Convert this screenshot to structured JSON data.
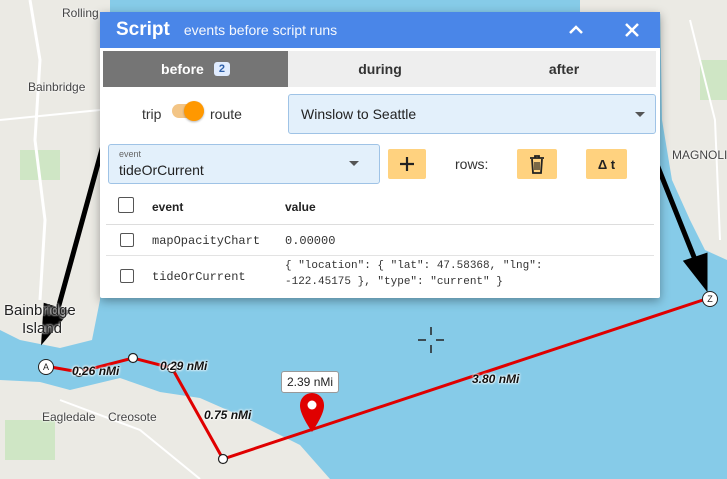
{
  "panel": {
    "title": "Script",
    "subtitle": "events before script runs",
    "tabs": [
      {
        "label": "before",
        "badge": "2"
      },
      {
        "label": "during"
      },
      {
        "label": "after"
      }
    ],
    "toggle": {
      "left_label": "trip",
      "right_label": "route",
      "on": true
    },
    "route_select": {
      "value": "Winslow to Seattle"
    },
    "event_select": {
      "label": "event",
      "value": "tideOrCurrent"
    },
    "rows_label": "rows:",
    "delta_label": "Δ t",
    "table": {
      "columns": [
        "event",
        "value"
      ],
      "rows": [
        {
          "event": "mapOpacityChart",
          "value": "0.00000"
        },
        {
          "event": "tideOrCurrent",
          "value_line1": "{ \"location\": { \"lat\": 47.58368, \"lng\":",
          "value_line2": "-122.45175 }, \"type\": \"current\" }"
        }
      ]
    }
  },
  "map": {
    "places": [
      {
        "text": "Rolling",
        "kind": "small"
      },
      {
        "text": "Bainbridge",
        "kind": "small"
      },
      {
        "text": "Bainbridge",
        "kind": "big"
      },
      {
        "text": "Island",
        "kind": "big"
      },
      {
        "text": "Eagledale",
        "kind": "small"
      },
      {
        "text": "Creosote",
        "kind": "small"
      },
      {
        "text": "MAGNOLI",
        "kind": "small"
      }
    ],
    "legs": [
      {
        "distance": "0.26 nMi"
      },
      {
        "distance": "0.29 nMi"
      },
      {
        "distance": "0.75 nMi"
      },
      {
        "distance": "3.80 nMi"
      }
    ],
    "markers": {
      "start": "A",
      "end": "Z"
    },
    "tooltip": "2.39 nMi",
    "colors": {
      "route": "#e00000",
      "water": "#86cbe8",
      "land": "#ebeae4",
      "header": "#4a86e8",
      "accent": "#ff9800"
    }
  }
}
